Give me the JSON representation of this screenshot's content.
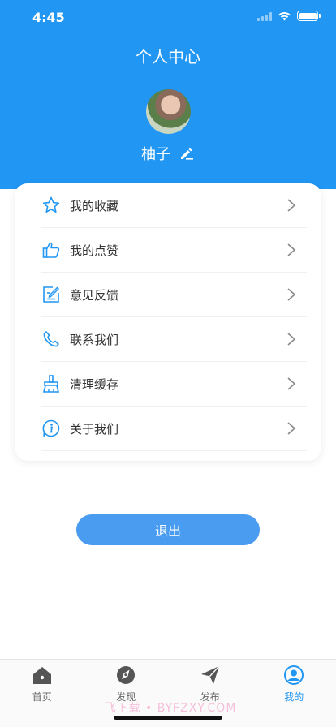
{
  "status_bar": {
    "time": "4:45"
  },
  "header": {
    "title": "个人中心",
    "username": "柚子"
  },
  "menu": {
    "items": [
      {
        "label": "我的收藏",
        "icon": "star-icon"
      },
      {
        "label": "我的点赞",
        "icon": "thumbs-up-icon"
      },
      {
        "label": "意见反馈",
        "icon": "feedback-icon"
      },
      {
        "label": "联系我们",
        "icon": "phone-icon"
      },
      {
        "label": "清理缓存",
        "icon": "broom-icon"
      },
      {
        "label": "关于我们",
        "icon": "info-icon"
      }
    ]
  },
  "logout": {
    "label": "退出"
  },
  "tab_bar": {
    "active": "我的",
    "tabs": [
      {
        "label": "首页",
        "icon": "home-icon"
      },
      {
        "label": "发现",
        "icon": "discover-icon"
      },
      {
        "label": "发布",
        "icon": "send-icon"
      },
      {
        "label": "我的",
        "icon": "profile-icon"
      }
    ]
  },
  "watermark": {
    "text": "飞下载 • BYFZXY.COM"
  },
  "colors": {
    "primary": "#2196F3",
    "button": "#4A9CF0",
    "icon_blue": "#2196F3",
    "text": "#333333"
  }
}
